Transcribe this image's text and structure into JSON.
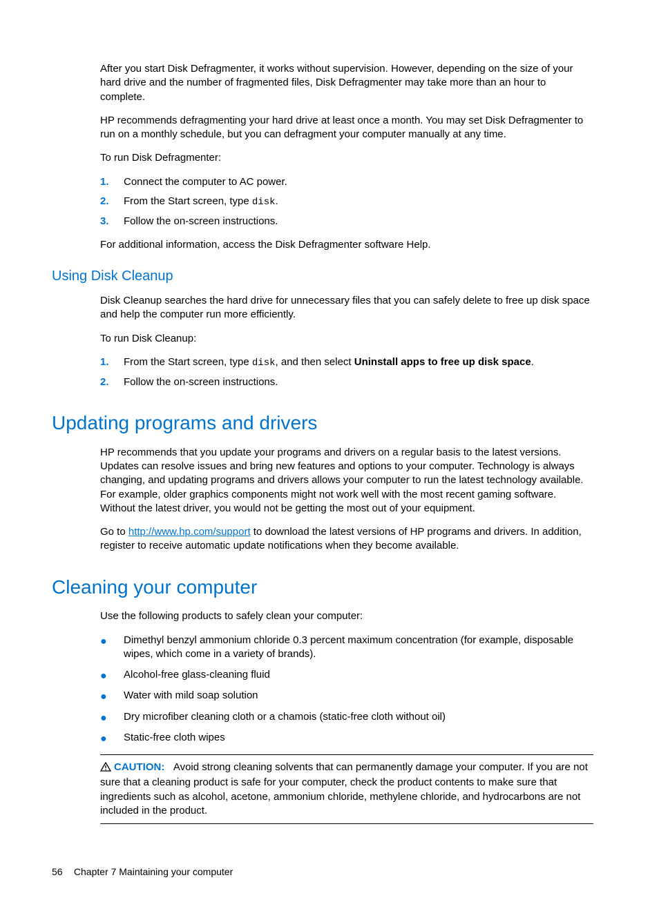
{
  "intro": {
    "p1": "After you start Disk Defragmenter, it works without supervision. However, depending on the size of your hard drive and the number of fragmented files, Disk Defragmenter may take more than an hour to complete.",
    "p2": "HP recommends defragmenting your hard drive at least once a month. You may set Disk Defragmenter to run on a monthly schedule, but you can defragment your computer manually at any time.",
    "p3": "To run Disk Defragmenter:",
    "steps": {
      "n1": "1.",
      "s1": "Connect the computer to AC power.",
      "n2": "2.",
      "s2a": "From the Start screen, type ",
      "s2code": "disk",
      "s2b": ".",
      "n3": "3.",
      "s3": "Follow the on-screen instructions."
    },
    "p4": "For additional information, access the Disk Defragmenter software Help."
  },
  "diskcleanup": {
    "heading": "Using Disk Cleanup",
    "p1": "Disk Cleanup searches the hard drive for unnecessary files that you can safely delete to free up disk space and help the computer run more efficiently.",
    "p2": "To run Disk Cleanup:",
    "steps": {
      "n1": "1.",
      "s1a": "From the Start screen, type ",
      "s1code": "disk",
      "s1b": ", and then select ",
      "s1bold": "Uninstall apps to free up disk space",
      "s1c": ".",
      "n2": "2.",
      "s2": "Follow the on-screen instructions."
    }
  },
  "updating": {
    "heading": "Updating programs and drivers",
    "p1": "HP recommends that you update your programs and drivers on a regular basis to the latest versions. Updates can resolve issues and bring new features and options to your computer. Technology is always changing, and updating programs and drivers allows your computer to run the latest technology available. For example, older graphics components might not work well with the most recent gaming software. Without the latest driver, you would not be getting the most out of your equipment.",
    "p2a": "Go to ",
    "p2link": "http://www.hp.com/support",
    "p2b": " to download the latest versions of HP programs and drivers. In addition, register to receive automatic update notifications when they become available."
  },
  "cleaning": {
    "heading": "Cleaning your computer",
    "p1": "Use the following products to safely clean your computer:",
    "bullets": {
      "b1": "Dimethyl benzyl ammonium chloride 0.3 percent maximum concentration (for example, disposable wipes, which come in a variety of brands).",
      "b2": "Alcohol-free glass-cleaning fluid",
      "b3": "Water with mild soap solution",
      "b4": "Dry microfiber cleaning cloth or a chamois (static-free cloth without oil)",
      "b5": "Static-free cloth wipes"
    },
    "caution_label": "CAUTION:",
    "caution_text": "Avoid strong cleaning solvents that can permanently damage your computer. If you are not sure that a cleaning product is safe for your computer, check the product contents to make sure that ingredients such as alcohol, acetone, ammonium chloride, methylene chloride, and hydrocarbons are not included in the product."
  },
  "footer": {
    "page": "56",
    "chapter": "Chapter 7   Maintaining your computer"
  }
}
